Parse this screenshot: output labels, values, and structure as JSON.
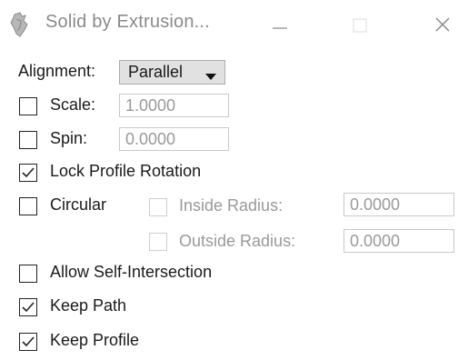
{
  "window": {
    "title": "Solid by Extrusion...",
    "icon": "solid-extrusion-icon",
    "controls": {
      "minimize": "minimize-icon",
      "maximize": "maximize-icon",
      "close": "close-icon"
    }
  },
  "alignment": {
    "label": "Alignment:",
    "value": "Parallel",
    "icon": "chevron-down-icon"
  },
  "scale": {
    "label": "Scale:",
    "checked": false,
    "value": "1.0000"
  },
  "spin": {
    "label": "Spin:",
    "checked": false,
    "value": "0.0000"
  },
  "lock_profile_rotation": {
    "label": "Lock Profile Rotation",
    "checked": true
  },
  "circular": {
    "label": "Circular",
    "checked": false
  },
  "inside_radius": {
    "label": "Inside Radius:",
    "checked": false,
    "value": "0.0000"
  },
  "outside_radius": {
    "label": "Outside Radius:",
    "checked": false,
    "value": "0.0000"
  },
  "allow_self_intersection": {
    "label": "Allow Self-Intersection",
    "checked": false
  },
  "keep_path": {
    "label": "Keep Path",
    "checked": true
  },
  "keep_profile": {
    "label": "Keep Profile",
    "checked": true
  },
  "colors": {
    "text": "#1a1a1a",
    "disabled_text": "#9a9a9a",
    "title_text": "#8a8a8a",
    "dropdown_bg": "#e1e1e1"
  }
}
